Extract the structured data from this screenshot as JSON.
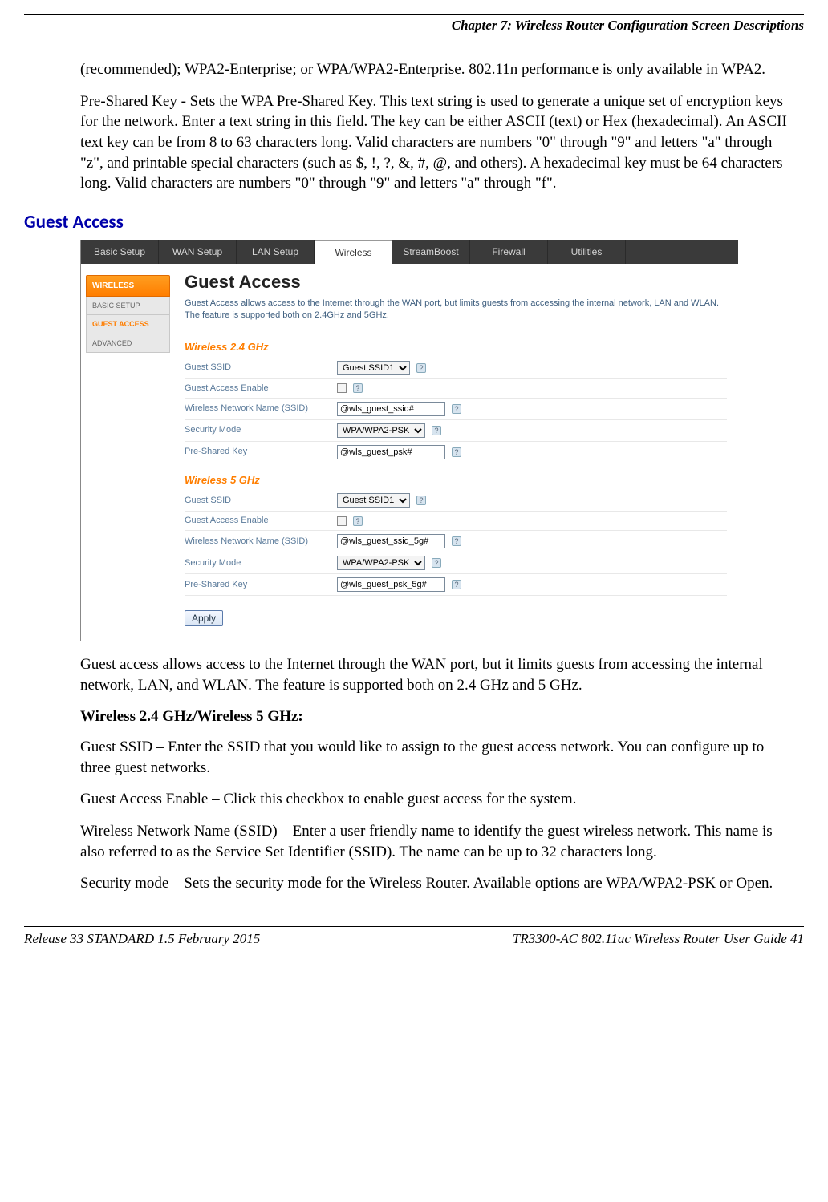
{
  "header": {
    "chapter_line": "Chapter 7: Wireless Router Configuration Screen Descriptions"
  },
  "text": {
    "p1": "(recommended); WPA2-Enterprise; or WPA/WPA2-Enterprise.  802.11n performance is only available in WPA2.",
    "p2": "Pre-Shared Key - Sets the WPA Pre-Shared Key.  This text string is used to generate a unique set of encryption keys for the network.  Enter a text string in this field.  The key can be either ASCII (text) or Hex (hexadecimal).  An ASCII text key can be from 8 to 63 characters long.  Valid characters are numbers \"0\" through \"9\" and letters \"a\" through \"z\", and printable special characters (such as $, !, ?, &, #, @, and others).  A hexadecimal key must be 64 characters long.  Valid characters are numbers \"0\" through \"9\" and letters \"a\" through \"f\".",
    "section_heading": "Guest Access",
    "p3": "Guest access allows access to the Internet through the WAN port, but it limits guests from accessing the internal network, LAN, and WLAN. The feature is supported both on 2.4 GHz and 5 GHz.",
    "sub_heading": "Wireless 2.4 GHz/Wireless 5 GHz:",
    "p4": "Guest SSID – Enter the SSID that you would like to assign to the guest access network. You can configure up to three guest networks.",
    "p5": "Guest Access Enable – Click this checkbox to enable guest access for the system.",
    "p6": "Wireless Network Name (SSID) – Enter a user friendly name to identify the guest wireless network. This name is also referred to as the Service Set Identifier (SSID). The name can be up to 32 characters long.",
    "p7": "Security mode – Sets the security mode for the Wireless Router. Available options are WPA/WPA2-PSK or Open."
  },
  "screenshot": {
    "nav": [
      "Basic Setup",
      "WAN Setup",
      "LAN Setup",
      "Wireless",
      "StreamBoost",
      "Firewall",
      "Utilities"
    ],
    "nav_active_index": 3,
    "sidebar": {
      "header": "WIRELESS",
      "items": [
        "BASIC SETUP",
        "GUEST ACCESS",
        "ADVANCED"
      ],
      "selected_index": 1
    },
    "content_title": "Guest Access",
    "content_sub": "Guest Access allows access to the Internet through the WAN port, but limits guests from accessing the internal network, LAN and WLAN. The feature is supported both on 2.4GHz and 5GHz.",
    "band24_title": "Wireless 2.4 GHz",
    "band5_title": "Wireless 5 GHz",
    "rows24": [
      {
        "label": "Guest SSID",
        "type": "select",
        "value": "Guest SSID1"
      },
      {
        "label": "Guest Access Enable",
        "type": "checkbox"
      },
      {
        "label": "Wireless Network Name (SSID)",
        "type": "text",
        "value": "@wls_guest_ssid#"
      },
      {
        "label": "Security Mode",
        "type": "select",
        "value": "WPA/WPA2-PSK"
      },
      {
        "label": "Pre-Shared Key",
        "type": "text",
        "value": "@wls_guest_psk#"
      }
    ],
    "rows5": [
      {
        "label": "Guest SSID",
        "type": "select",
        "value": "Guest SSID1"
      },
      {
        "label": "Guest Access Enable",
        "type": "checkbox"
      },
      {
        "label": "Wireless Network Name (SSID)",
        "type": "text",
        "value": "@wls_guest_ssid_5g#"
      },
      {
        "label": "Security Mode",
        "type": "select",
        "value": "WPA/WPA2-PSK"
      },
      {
        "label": "Pre-Shared Key",
        "type": "text",
        "value": "@wls_guest_psk_5g#"
      }
    ],
    "apply_label": "Apply"
  },
  "footer": {
    "left": "Release 33 STANDARD 1.5    February 2015",
    "right": "TR3300-AC 802.11ac Wireless Router User Guide    41"
  }
}
